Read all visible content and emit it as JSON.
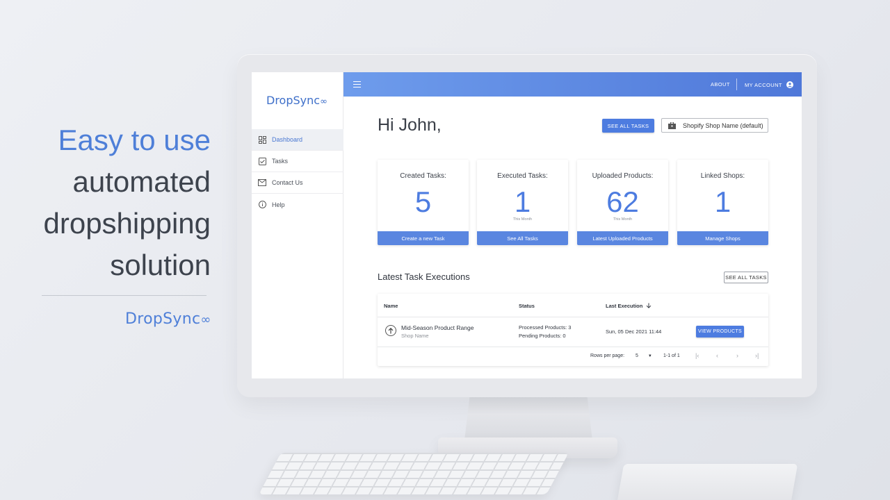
{
  "hero": {
    "line1": "Easy to use",
    "line2": "automated",
    "line3": "dropshipping",
    "line4": "solution",
    "logo": "DropSync",
    "logo_mark": "∞"
  },
  "app": {
    "logo": "DropSync",
    "logo_mark": "∞",
    "sidebar": {
      "items": [
        {
          "label": "Dashboard",
          "icon": "dashboard-icon",
          "active": true
        },
        {
          "label": "Tasks",
          "icon": "checkbox-icon"
        },
        {
          "label": "Contact Us",
          "icon": "mail-icon"
        },
        {
          "label": "Help",
          "icon": "info-icon"
        }
      ]
    },
    "topbar": {
      "about": "ABOUT",
      "account": "MY ACCOUNT"
    },
    "greeting": "Hi John,",
    "see_all_tasks": "SEE ALL TASKS",
    "shop_select": "Shopify Shop Name (default)",
    "cards": [
      {
        "title": "Created Tasks:",
        "value": "5",
        "sub": "",
        "button": "Create a new Task"
      },
      {
        "title": "Executed Tasks:",
        "value": "1",
        "sub": "This Month",
        "button": "See All Tasks"
      },
      {
        "title": "Uploaded Products:",
        "value": "62",
        "sub": "This Month",
        "button": "Latest Uploaded Products"
      },
      {
        "title": "Linked Shops:",
        "value": "1",
        "sub": "",
        "button": "Manage Shops"
      }
    ],
    "executions": {
      "title": "Latest Task Executions",
      "see_all": "SEE ALL TASKS",
      "headers": {
        "name": "Name",
        "status": "Status",
        "last_execution": "Last Execution"
      },
      "rows": [
        {
          "name": "Mid-Season Product Range",
          "shop": "Shop Name",
          "processed": "Processed Products: 3",
          "pending": "Pending Products: 0",
          "date": "Sun, 05 Dec 2021 11:44",
          "action": "VIEW PRODUCTS"
        }
      ],
      "pagination": {
        "rows_per_page_label": "Rows per page:",
        "rows_per_page": "5",
        "range": "1-1 of 1"
      }
    }
  },
  "colors": {
    "accent": "#4d7ce0",
    "topbar_start": "#6e9cec",
    "topbar_end": "#4f78d9"
  }
}
